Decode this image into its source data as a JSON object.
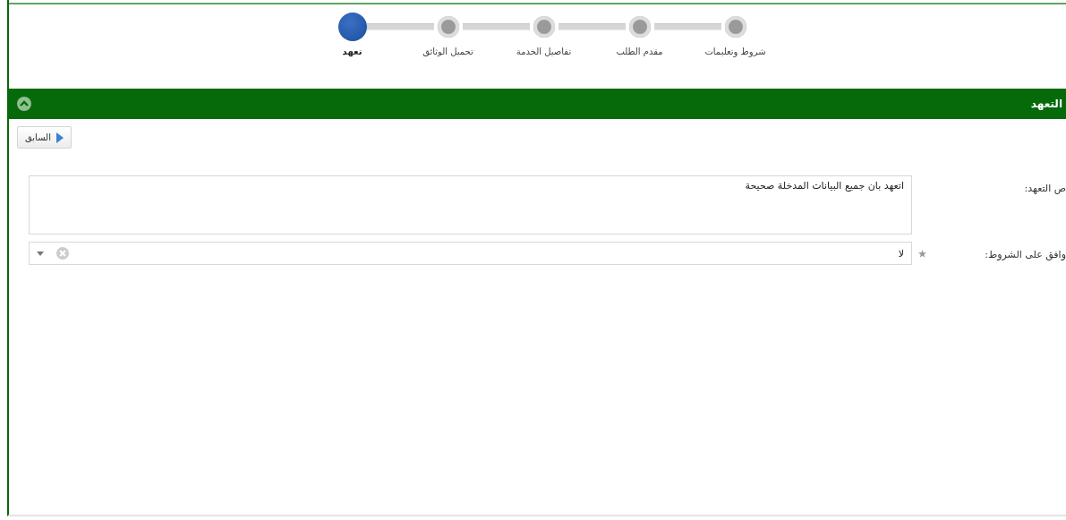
{
  "steps": [
    {
      "label": "شروط وتعليمات",
      "selected": false
    },
    {
      "label": "مقدم الطلب",
      "selected": false
    },
    {
      "label": "تفاصيل الخدمة",
      "selected": false
    },
    {
      "label": "تحميل الوثائق",
      "selected": false
    },
    {
      "label": "تعهد",
      "selected": true
    }
  ],
  "panel": {
    "title": "التعهد",
    "expanded": true
  },
  "back_button": {
    "label": "السابق"
  },
  "fields": [
    {
      "kind": "textarea",
      "label": "ص التعهد:",
      "value": "اتعهد بان جميع البيانات المدخلة صحيحة"
    },
    {
      "kind": "select",
      "label": "وافق على الشروط:",
      "value": "لا",
      "required": true
    }
  ]
}
